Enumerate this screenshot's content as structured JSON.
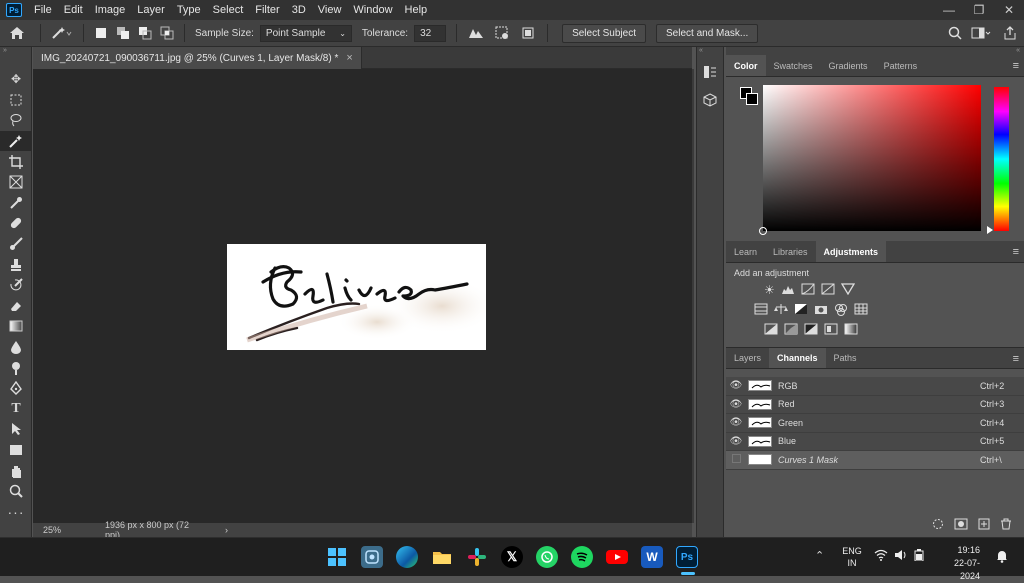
{
  "app": {
    "logo": "Ps"
  },
  "menu": [
    "File",
    "Edit",
    "Image",
    "Layer",
    "Type",
    "Select",
    "Filter",
    "3D",
    "View",
    "Window",
    "Help"
  ],
  "window_controls": {
    "minimize": "—",
    "restore": "❐",
    "close": "✕"
  },
  "options": {
    "sample_size_label": "Sample Size:",
    "sample_size_value": "Point Sample",
    "tolerance_label": "Tolerance:",
    "tolerance_value": "32",
    "select_subject": "Select Subject",
    "select_and_mask": "Select and Mask..."
  },
  "document": {
    "tab_title": "IMG_20240721_090036711.jpg @ 25% (Curves 1, Layer Mask/8) *",
    "close": "×",
    "zoom": "25%",
    "dimensions": "1936 px x 800 px (72 ppi)",
    "status_arrow": "›"
  },
  "color_panel": {
    "tabs": [
      "Color",
      "Swatches",
      "Gradients",
      "Patterns"
    ],
    "active_tab": "Color",
    "foreground_color": "#000000",
    "background_color": "#000000",
    "hue_color": "#ff0000"
  },
  "adjust_panel": {
    "tabs": [
      "Learn",
      "Libraries",
      "Adjustments"
    ],
    "active_tab": "Adjustments",
    "add_label": "Add an adjustment"
  },
  "channels_panel": {
    "tabs": [
      "Layers",
      "Channels",
      "Paths"
    ],
    "active_tab": "Channels",
    "rows": [
      {
        "name": "RGB",
        "shortcut": "Ctrl+2"
      },
      {
        "name": "Red",
        "shortcut": "Ctrl+3"
      },
      {
        "name": "Green",
        "shortcut": "Ctrl+4"
      },
      {
        "name": "Blue",
        "shortcut": "Ctrl+5"
      },
      {
        "name": "Curves 1 Mask",
        "shortcut": "Ctrl+\\"
      }
    ]
  },
  "taskbar": {
    "lang_top": "ENG",
    "lang_bottom": "IN",
    "time": "19:16",
    "date": "22-07-2024"
  }
}
